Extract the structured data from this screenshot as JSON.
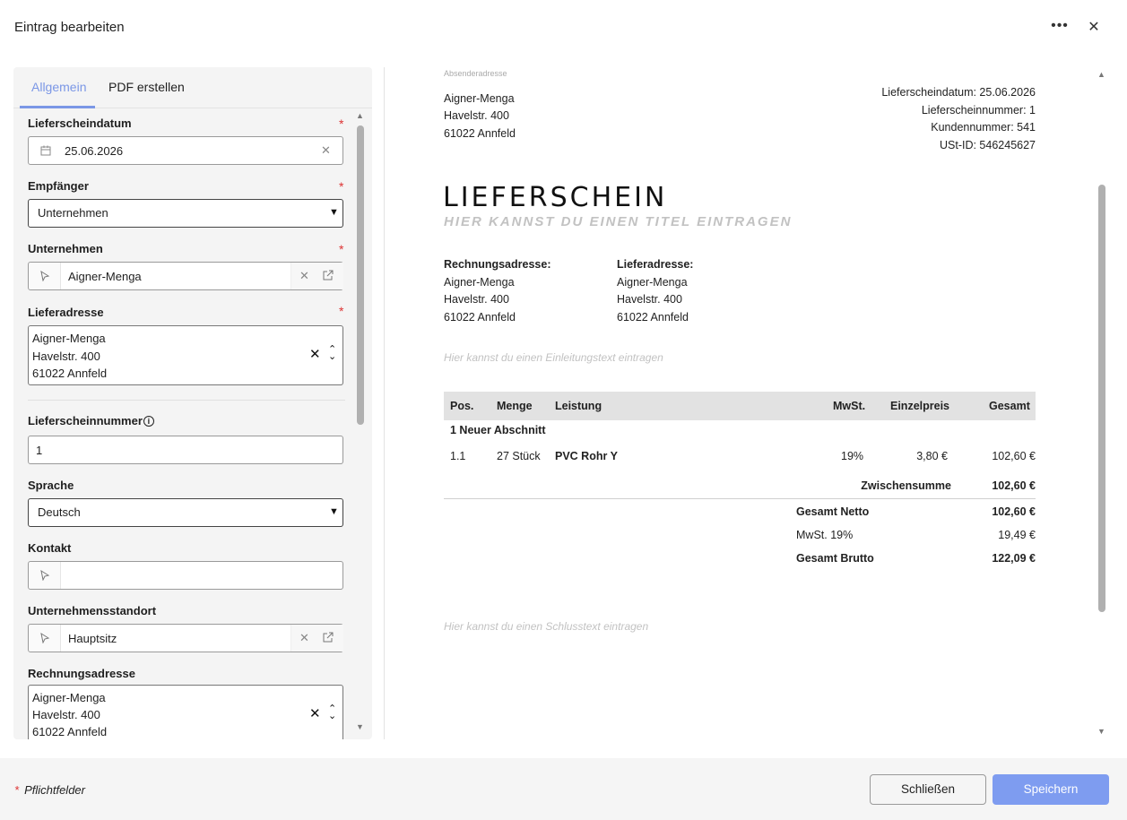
{
  "dialog": {
    "title": "Eintrag bearbeiten",
    "more_icon": "more-horizontal-icon",
    "close_icon": "close-icon"
  },
  "tabs": [
    {
      "label": "Allgemein",
      "active": true
    },
    {
      "label": "PDF erstellen",
      "active": false
    }
  ],
  "form": {
    "lieferscheindatum": {
      "label": "Lieferscheindatum",
      "required": "*",
      "value": "25.06.2026"
    },
    "empfaenger": {
      "label": "Empfänger",
      "required": "*",
      "value": "Unternehmen"
    },
    "unternehmen": {
      "label": "Unternehmen",
      "required": "*",
      "value": "Aigner-Menga"
    },
    "lieferadresse": {
      "label": "Lieferadresse",
      "required": "*",
      "lines": [
        "Aigner-Menga",
        "Havelstr. 400",
        "61022 Annfeld"
      ]
    },
    "lieferscheinnummer": {
      "label": "Lieferscheinnummer",
      "value": "1"
    },
    "sprache": {
      "label": "Sprache",
      "value": "Deutsch"
    },
    "kontakt": {
      "label": "Kontakt",
      "value": ""
    },
    "standort": {
      "label": "Unternehmensstandort",
      "value": "Hauptsitz"
    },
    "rechnungsadresse": {
      "label": "Rechnungsadresse",
      "lines": [
        "Aigner-Menga",
        "Havelstr. 400",
        "61022 Annfeld"
      ]
    }
  },
  "preview": {
    "sender_caption": "Absenderadresse",
    "sender": [
      "Aigner-Menga",
      "Havelstr. 400",
      "61022 Annfeld"
    ],
    "meta": [
      "Lieferscheindatum: 25.06.2026",
      "Lieferscheinnummer: 1",
      "Kundennummer: 541",
      "USt-ID: 546245627"
    ],
    "doc_title": "LIEFERSCHEIN",
    "doc_subtitle": "HIER KANNST DU EINEN TITEL EINTRAGEN",
    "billing_heading": "Rechnungsadresse:",
    "billing": [
      "Aigner-Menga",
      "Havelstr. 400",
      "61022 Annfeld"
    ],
    "delivery_heading": "Lieferadresse:",
    "delivery": [
      "Aigner-Menga",
      "Havelstr. 400",
      "61022 Annfeld"
    ],
    "intro_hint": "Hier kannst du einen Einleitungstext eintragen",
    "table_headers": [
      "Pos.",
      "Menge",
      "Leistung",
      "MwSt.",
      "Einzelpreis",
      "Gesamt"
    ],
    "section": "1 Neuer Abschnitt",
    "row": {
      "pos": "1.1",
      "menge": "27 Stück",
      "leistung": "PVC Rohr Y",
      "mwst": "19%",
      "einzelpreis": "3,80 €",
      "gesamt": "102,60 €"
    },
    "zwischensumme_label": "Zwischensumme",
    "zwischensumme": "102,60 €",
    "netto_label": "Gesamt Netto",
    "netto": "102,60 €",
    "mwst_label": "MwSt. 19%",
    "mwst": "19,49 €",
    "brutto_label": "Gesamt Brutto",
    "brutto": "122,09 €",
    "closing_hint": "Hier kannst du einen Schlusstext eintragen"
  },
  "footer": {
    "required_star": "*",
    "required_note": "Pflichtfelder",
    "close_label": "Schließen",
    "save_label": "Speichern"
  }
}
